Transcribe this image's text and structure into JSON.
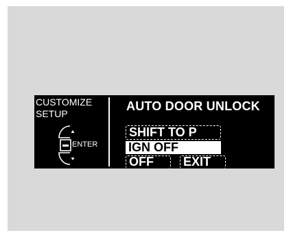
{
  "left_header": {
    "line1": "CUSTOMIZE",
    "line2": "SETUP"
  },
  "controller": {
    "enter_label": "ENTER",
    "icons": [
      "up-arrow-icon",
      "down-arrow-icon",
      "menu-button-icon"
    ]
  },
  "menu": {
    "title": "AUTO DOOR UNLOCK",
    "options": [
      {
        "label": "SHIFT TO P",
        "selected": false
      },
      {
        "label": "IGN OFF",
        "selected": true
      },
      {
        "label": "OFF",
        "selected": false
      },
      {
        "label": "EXIT",
        "selected": false
      }
    ]
  },
  "colors": {
    "background": "#d9d9d9",
    "screen": "#000000",
    "text": "#ffffff"
  }
}
